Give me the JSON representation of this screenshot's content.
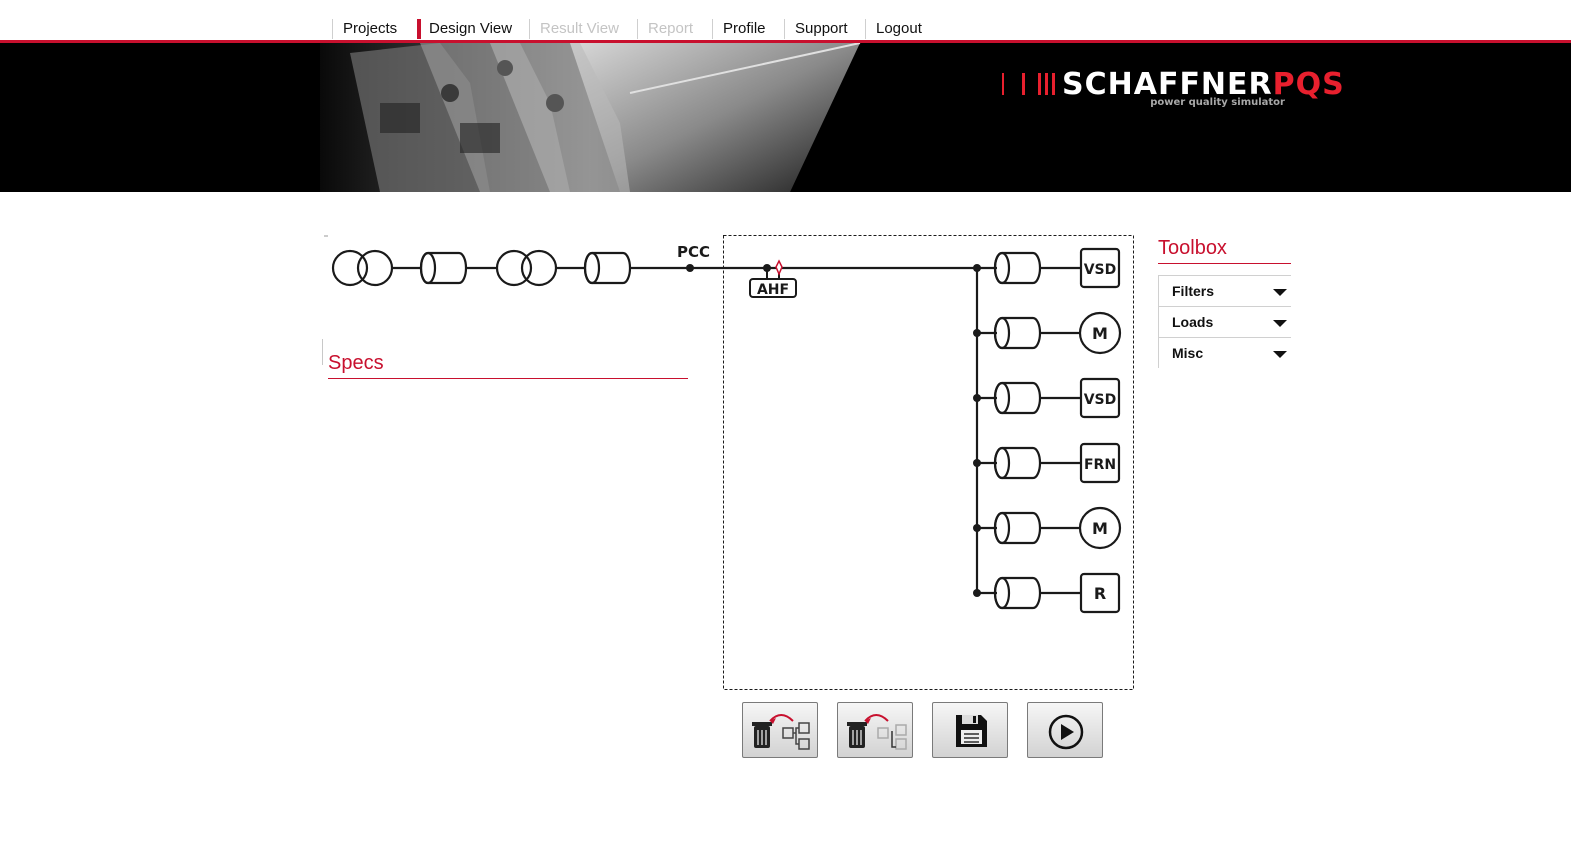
{
  "nav": {
    "items": [
      {
        "label": "Projects",
        "state": "normal"
      },
      {
        "label": "Design View",
        "state": "active"
      },
      {
        "label": "Result View",
        "state": "disabled"
      },
      {
        "label": "Report",
        "state": "disabled"
      },
      {
        "label": "Profile",
        "state": "normal"
      },
      {
        "label": "Support",
        "state": "normal"
      },
      {
        "label": "Logout",
        "state": "normal"
      }
    ]
  },
  "brand": {
    "name_white": "SCHAFFNER",
    "name_red": "PQS",
    "tagline": "power quality simulator",
    "accent_color": "#c8102e"
  },
  "schematic": {
    "pcc_label": "PCC",
    "filter_label": "AHF",
    "loads": [
      "VSD",
      "M",
      "VSD",
      "FRN",
      "M",
      "R"
    ]
  },
  "specs": {
    "title": "Specs"
  },
  "toolbox": {
    "title": "Toolbox",
    "items": [
      {
        "label": "Filters"
      },
      {
        "label": "Loads"
      },
      {
        "label": "Misc"
      }
    ]
  },
  "actions": [
    {
      "icon": "delete-network-icon"
    },
    {
      "icon": "delete-branch-icon"
    },
    {
      "icon": "save-icon"
    },
    {
      "icon": "play-icon"
    }
  ]
}
